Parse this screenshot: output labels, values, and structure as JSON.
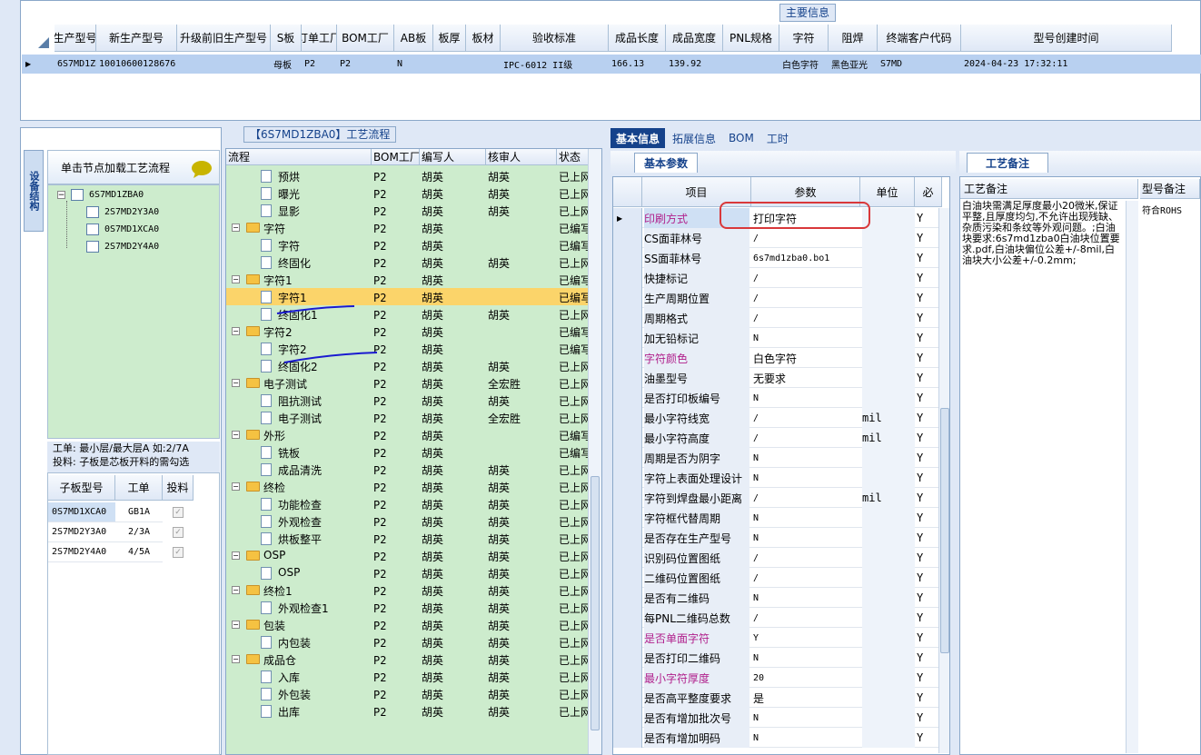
{
  "top": {
    "title": "主要信息",
    "columns": [
      "生产型号",
      "新生产型号",
      "升级前旧生产型号",
      "S板",
      "订单工厂",
      "BOM工厂",
      "AB板",
      "板厚",
      "板材",
      "验收标准",
      "成品长度",
      "成品宽度",
      "PNL规格",
      "字符",
      "阻焊",
      "终端客户代码",
      "型号创建时间"
    ],
    "row": [
      "6S7MD1ZBA0",
      "10010600128676",
      "",
      "母板",
      "P2",
      "P2",
      "N",
      "",
      "",
      "IPC-6012 II级",
      "166.13",
      "139.92",
      "",
      "白色字符",
      "黑色亚光",
      "S7MD",
      "2024-04-23 17:32:11"
    ]
  },
  "left": {
    "vertical_tab": "设备结构",
    "load_label": "单击节点加载工艺流程",
    "tree": {
      "root": "6S7MD1ZBA0",
      "children": [
        "2S7MD2Y3A0",
        "0S7MD1XCA0",
        "2S7MD2Y4A0"
      ]
    },
    "note_line1": "工单: 最小层/最大层A 如:2/7A",
    "note_line2": "投料: 子板是芯板开料的需勾选",
    "sub_columns": [
      "子板型号",
      "工单",
      "投料"
    ],
    "sub_rows": [
      {
        "model": "0S7MD1XCA0",
        "order": "GB1A",
        "checked": true
      },
      {
        "model": "2S7MD2Y3A0",
        "order": "2/3A",
        "checked": true
      },
      {
        "model": "2S7MD2Y4A0",
        "order": "4/5A",
        "checked": true
      }
    ]
  },
  "flow": {
    "title": "【6S7MD1ZBA0】工艺流程",
    "columns": [
      "流程",
      "BOM工厂",
      "编写人",
      "核审人",
      "状态"
    ],
    "rows": [
      {
        "name": "预烘",
        "level": 1,
        "bom": "P2",
        "writer": "胡英",
        "reviewer": "胡英",
        "status": "已上网"
      },
      {
        "name": "曝光",
        "level": 1,
        "bom": "P2",
        "writer": "胡英",
        "reviewer": "胡英",
        "status": "已上网"
      },
      {
        "name": "显影",
        "level": 1,
        "bom": "P2",
        "writer": "胡英",
        "reviewer": "胡英",
        "status": "已上网"
      },
      {
        "name": "字符",
        "level": 0,
        "bom": "P2",
        "writer": "胡英",
        "reviewer": "",
        "status": "已编写"
      },
      {
        "name": "字符",
        "level": 1,
        "bom": "P2",
        "writer": "胡英",
        "reviewer": "",
        "status": "已编写"
      },
      {
        "name": "终固化",
        "level": 1,
        "bom": "P2",
        "writer": "胡英",
        "reviewer": "胡英",
        "status": "已上网"
      },
      {
        "name": "字符1",
        "level": 0,
        "bom": "P2",
        "writer": "胡英",
        "reviewer": "",
        "status": "已编写"
      },
      {
        "name": "字符1",
        "level": 1,
        "bom": "P2",
        "writer": "胡英",
        "reviewer": "",
        "status": "已编写",
        "selected": true
      },
      {
        "name": "终固化1",
        "level": 1,
        "bom": "P2",
        "writer": "胡英",
        "reviewer": "胡英",
        "status": "已上网"
      },
      {
        "name": "字符2",
        "level": 0,
        "bom": "P2",
        "writer": "胡英",
        "reviewer": "",
        "status": "已编写"
      },
      {
        "name": "字符2",
        "level": 1,
        "bom": "P2",
        "writer": "胡英",
        "reviewer": "",
        "status": "已编写"
      },
      {
        "name": "终固化2",
        "level": 1,
        "bom": "P2",
        "writer": "胡英",
        "reviewer": "胡英",
        "status": "已上网"
      },
      {
        "name": "电子测试",
        "level": 0,
        "bom": "P2",
        "writer": "胡英",
        "reviewer": "全宏胜",
        "status": "已上网"
      },
      {
        "name": "阻抗测试",
        "level": 1,
        "bom": "P2",
        "writer": "胡英",
        "reviewer": "胡英",
        "status": "已上网"
      },
      {
        "name": "电子测试",
        "level": 1,
        "bom": "P2",
        "writer": "胡英",
        "reviewer": "全宏胜",
        "status": "已上网"
      },
      {
        "name": "外形",
        "level": 0,
        "bom": "P2",
        "writer": "胡英",
        "reviewer": "",
        "status": "已编写"
      },
      {
        "name": "铣板",
        "level": 1,
        "bom": "P2",
        "writer": "胡英",
        "reviewer": "",
        "status": "已编写"
      },
      {
        "name": "成品清洗",
        "level": 1,
        "bom": "P2",
        "writer": "胡英",
        "reviewer": "胡英",
        "status": "已上网"
      },
      {
        "name": "终检",
        "level": 0,
        "bom": "P2",
        "writer": "胡英",
        "reviewer": "胡英",
        "status": "已上网"
      },
      {
        "name": "功能检查",
        "level": 1,
        "bom": "P2",
        "writer": "胡英",
        "reviewer": "胡英",
        "status": "已上网"
      },
      {
        "name": "外观检查",
        "level": 1,
        "bom": "P2",
        "writer": "胡英",
        "reviewer": "胡英",
        "status": "已上网"
      },
      {
        "name": "烘板整平",
        "level": 1,
        "bom": "P2",
        "writer": "胡英",
        "reviewer": "胡英",
        "status": "已上网"
      },
      {
        "name": "OSP",
        "level": 0,
        "bom": "P2",
        "writer": "胡英",
        "reviewer": "胡英",
        "status": "已上网"
      },
      {
        "name": "OSP",
        "level": 1,
        "bom": "P2",
        "writer": "胡英",
        "reviewer": "胡英",
        "status": "已上网"
      },
      {
        "name": "终检1",
        "level": 0,
        "bom": "P2",
        "writer": "胡英",
        "reviewer": "胡英",
        "status": "已上网"
      },
      {
        "name": "外观检查1",
        "level": 1,
        "bom": "P2",
        "writer": "胡英",
        "reviewer": "胡英",
        "status": "已上网"
      },
      {
        "name": "包装",
        "level": 0,
        "bom": "P2",
        "writer": "胡英",
        "reviewer": "胡英",
        "status": "已上网"
      },
      {
        "name": "内包装",
        "level": 1,
        "bom": "P2",
        "writer": "胡英",
        "reviewer": "胡英",
        "status": "已上网"
      },
      {
        "name": "成品仓",
        "level": 0,
        "bom": "P2",
        "writer": "胡英",
        "reviewer": "胡英",
        "status": "已上网"
      },
      {
        "name": "入库",
        "level": 1,
        "bom": "P2",
        "writer": "胡英",
        "reviewer": "胡英",
        "status": "已上网"
      },
      {
        "name": "外包装",
        "level": 1,
        "bom": "P2",
        "writer": "胡英",
        "reviewer": "胡英",
        "status": "已上网"
      },
      {
        "name": "出库",
        "level": 1,
        "bom": "P2",
        "writer": "胡英",
        "reviewer": "胡英",
        "status": "已上网"
      }
    ]
  },
  "right": {
    "tabs": [
      "基本信息",
      "拓展信息",
      "BOM",
      "工时"
    ],
    "sub_tab": "基本参数",
    "columns": [
      "项目",
      "参数",
      "单位",
      "必"
    ],
    "rows": [
      {
        "item": "印刷方式",
        "value": "打印字符",
        "unit": "",
        "req": "Y",
        "highlight": true,
        "selected": true
      },
      {
        "item": "CS面菲林号",
        "value": "/",
        "unit": "",
        "req": "Y"
      },
      {
        "item": "SS面菲林号",
        "value": "6s7md1zba0.bo1",
        "unit": "",
        "req": "Y"
      },
      {
        "item": "快捷标记",
        "value": "/",
        "unit": "",
        "req": "Y"
      },
      {
        "item": "生产周期位置",
        "value": "/",
        "unit": "",
        "req": "Y"
      },
      {
        "item": "周期格式",
        "value": "/",
        "unit": "",
        "req": "Y"
      },
      {
        "item": "加无铅标记",
        "value": "N",
        "unit": "",
        "req": "Y"
      },
      {
        "item": "字符颜色",
        "value": "白色字符",
        "unit": "",
        "req": "Y",
        "highlight": true
      },
      {
        "item": "油墨型号",
        "value": "无要求",
        "unit": "",
        "req": "Y"
      },
      {
        "item": "是否打印板编号",
        "value": "N",
        "unit": "",
        "req": "Y"
      },
      {
        "item": "最小字符线宽",
        "value": "/",
        "unit": "mil",
        "req": "Y"
      },
      {
        "item": "最小字符高度",
        "value": "/",
        "unit": "mil",
        "req": "Y"
      },
      {
        "item": "周期是否为阴字",
        "value": "N",
        "unit": "",
        "req": "Y"
      },
      {
        "item": "字符上表面处理设计",
        "value": "N",
        "unit": "",
        "req": "Y"
      },
      {
        "item": "字符到焊盘最小距离",
        "value": "/",
        "unit": "mil",
        "req": "Y"
      },
      {
        "item": "字符框代替周期",
        "value": "N",
        "unit": "",
        "req": "Y"
      },
      {
        "item": "是否存在生产型号",
        "value": "N",
        "unit": "",
        "req": "Y"
      },
      {
        "item": "识别码位置图纸",
        "value": "/",
        "unit": "",
        "req": "Y"
      },
      {
        "item": "二维码位置图纸",
        "value": "/",
        "unit": "",
        "req": "Y"
      },
      {
        "item": "是否有二维码",
        "value": "N",
        "unit": "",
        "req": "Y"
      },
      {
        "item": "每PNL二维码总数",
        "value": "/",
        "unit": "",
        "req": "Y"
      },
      {
        "item": "是否单面字符",
        "value": "Y",
        "unit": "",
        "req": "Y",
        "highlight": true
      },
      {
        "item": "是否打印二维码",
        "value": "N",
        "unit": "",
        "req": "Y"
      },
      {
        "item": "最小字符厚度",
        "value": "20",
        "unit": "",
        "req": "Y",
        "highlight": true
      },
      {
        "item": "是否高平整度要求",
        "value": "是",
        "unit": "",
        "req": "Y"
      },
      {
        "item": "是否有增加批次号",
        "value": "N",
        "unit": "",
        "req": "Y"
      },
      {
        "item": "是否有增加明码",
        "value": "N",
        "unit": "",
        "req": "Y"
      }
    ]
  },
  "notes": {
    "tab": "工艺备注",
    "col1": "工艺备注",
    "col2": "型号备注",
    "process_note": "白油块需满足厚度最小20微米,保证平整,且厚度均匀,不允许出现残缺、杂质污染和条纹等外观问题。;白油块要求:6s7md1zba0白油块位置要求.pdf,白油块偏位公差+/-8mil,白油块大小公差+/-0.2mm;",
    "model_note": "符合ROHS"
  },
  "colors": {
    "highlight_text": "#b0208c",
    "selected_row": "#fbd46a",
    "tree_bg": "#cdeccd",
    "annotation_red": "#d9383a",
    "annotation_blue": "#1a1ad0"
  }
}
